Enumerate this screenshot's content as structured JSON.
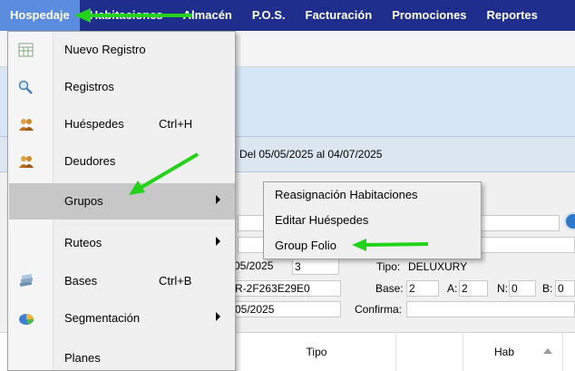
{
  "menubar": {
    "items": [
      "Hospedaje",
      "Habitaciones",
      "Almacén",
      "P.O.S.",
      "Facturación",
      "Promociones",
      "Reportes"
    ]
  },
  "header": {
    "date_range": "n Del 05/05/2025 al 04/07/2025"
  },
  "dropdown": {
    "items": [
      {
        "label": "Nuevo Registro",
        "shortcut": "",
        "icon": "spreadsheet-icon"
      },
      {
        "label": "Registros",
        "shortcut": "",
        "icon": "magnifier-icon"
      },
      {
        "label": "Huéspedes",
        "shortcut": "Ctrl+H",
        "icon": "people-icon"
      },
      {
        "label": "Deudores",
        "shortcut": "",
        "icon": "people-icon"
      },
      {
        "label": "Grupos",
        "shortcut": "",
        "icon": ""
      },
      {
        "label": "Ruteos",
        "shortcut": "",
        "icon": ""
      },
      {
        "label": "Bases",
        "shortcut": "Ctrl+B",
        "icon": "stack-icon"
      },
      {
        "label": "Segmentación",
        "shortcut": "",
        "icon": "pie-chart-icon"
      },
      {
        "label": "Planes",
        "shortcut": "",
        "icon": ""
      }
    ]
  },
  "submenu": {
    "items": [
      "Reasignación Habitaciones",
      "Editar Huéspedes",
      "Group Folio"
    ]
  },
  "form": {
    "date1": "05/2025",
    "num": "3",
    "tipo_label": "Tipo:",
    "tipo_value": "DELUXURY",
    "code": "R-2F263E29E0",
    "base_label": "Base:",
    "base_value": "2",
    "a_label": "A:",
    "a_value": "2",
    "n_label": "N:",
    "n_value": "0",
    "b_label": "B:",
    "b_value": "0",
    "date2": "05/2025",
    "confirma_label": "Confirma:"
  },
  "grid": {
    "col_tipo": "Tipo",
    "col_hab": "Hab"
  },
  "colors": {
    "menubar": "#1f2d8c",
    "active_menu": "#5a8ce0",
    "arrow": "#22d31a"
  }
}
